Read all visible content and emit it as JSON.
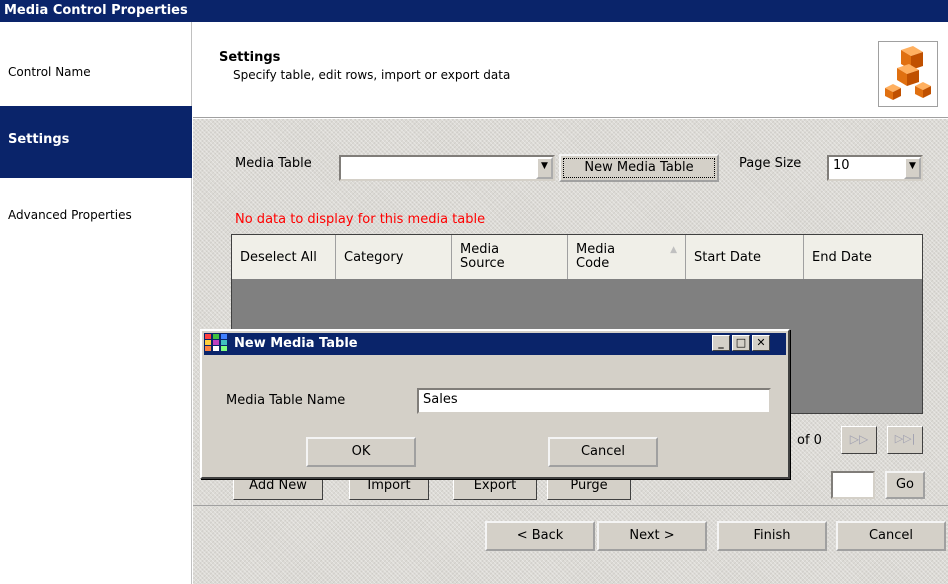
{
  "window": {
    "title": "Media Control Properties"
  },
  "nav": {
    "items": [
      {
        "label": "Control Name"
      },
      {
        "label": "Settings"
      },
      {
        "label": "Advanced Properties"
      }
    ]
  },
  "header": {
    "title": "Settings",
    "subtitle": "Specify table, edit rows, import or export data",
    "icon": "cubes-icon"
  },
  "settings": {
    "media_table_label": "Media Table",
    "media_table_value": "",
    "new_media_table_button": "New Media Table",
    "page_size_label": "Page Size",
    "page_size_value": "10",
    "message": "No data to display for this media table",
    "message_color": "#ff0000"
  },
  "grid": {
    "columns": [
      {
        "label": "Deselect All"
      },
      {
        "label": "Category"
      },
      {
        "label": "Media\nSource"
      },
      {
        "label": "Media\nCode"
      },
      {
        "label": "Start Date"
      },
      {
        "label": "End Date"
      }
    ],
    "sorted_column": "Media Code"
  },
  "pager": {
    "of_text": "of 0",
    "go_button": "Go",
    "page_input": ""
  },
  "actions": {
    "add_new": "Add New",
    "import": "Import",
    "export": "Export",
    "purge": "Purge"
  },
  "footer": {
    "back": "< Back",
    "next": "Next >",
    "finish": "Finish",
    "cancel": "Cancel"
  },
  "dialog": {
    "title": "New Media Table",
    "name_label": "Media Table Name",
    "name_value": "Sales",
    "ok": "OK",
    "cancel": "Cancel",
    "minimize": "_",
    "maximize": "□",
    "close": "✕"
  },
  "colors": {
    "titlebar": "#0a246a",
    "selected_nav": "#0a246a",
    "face": "#d4d0c8",
    "grid_bg": "#808080"
  }
}
